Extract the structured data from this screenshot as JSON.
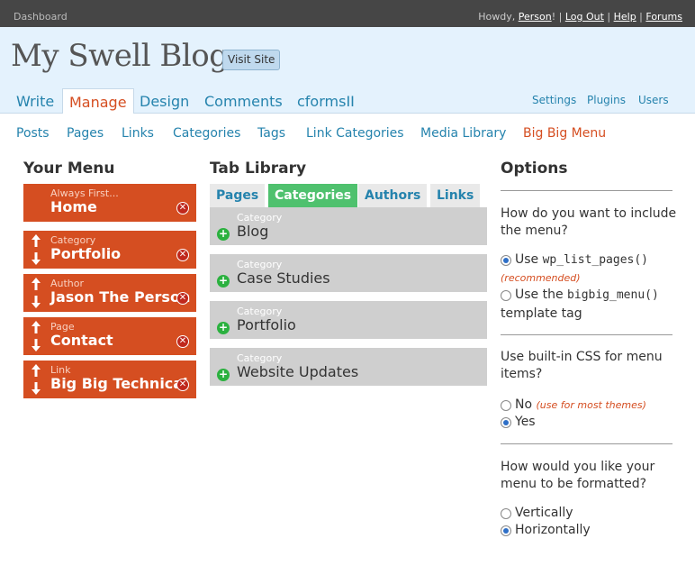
{
  "topbar": {
    "dashboard": "Dashboard",
    "howdy": "Howdy,",
    "user": "Person",
    "links": [
      "Log Out",
      "Help",
      "Forums"
    ]
  },
  "header": {
    "title": "My Swell Blog",
    "visit": "Visit Site"
  },
  "main_tabs": [
    "Write",
    "Manage",
    "Design",
    "Comments",
    "cformsII"
  ],
  "right_links": [
    "Settings",
    "Plugins",
    "Users"
  ],
  "submenu": [
    "Posts",
    "Pages",
    "Links",
    "Categories",
    "Tags",
    "Link Categories",
    "Media Library",
    "Big Big Menu"
  ],
  "your_menu": {
    "heading": "Your Menu",
    "items": [
      {
        "kind": "Always First...",
        "name": "Home"
      },
      {
        "kind": "Category",
        "name": "Portfolio"
      },
      {
        "kind": "Author",
        "name": "Jason The Person"
      },
      {
        "kind": "Page",
        "name": "Contact"
      },
      {
        "kind": "Link",
        "name": "Big Big Technical"
      }
    ]
  },
  "library": {
    "heading": "Tab Library",
    "tabs": [
      "Pages",
      "Categories",
      "Authors",
      "Links"
    ],
    "items": [
      {
        "kind": "Category",
        "name": "Blog"
      },
      {
        "kind": "Category",
        "name": "Case Studies"
      },
      {
        "kind": "Category",
        "name": "Portfolio"
      },
      {
        "kind": "Category",
        "name": "Website Updates"
      }
    ]
  },
  "options": {
    "heading": "Options",
    "q1": "How do you want to include the menu?",
    "q1_a": "Use",
    "q1_a_code": "wp_list_pages()",
    "q1_a_note": "(recommended)",
    "q1_b": "Use the",
    "q1_b_code": "bigbig_menu()",
    "q1_b_tail": "template tag",
    "q2": "Use built-in CSS for menu items?",
    "q2_a": "No",
    "q2_a_note": "(use for most themes)",
    "q2_b": "Yes",
    "q3": "How would you like your menu to be formatted?",
    "q3_a": "Vertically",
    "q3_b": "Horizontally"
  },
  "colors": {
    "accent": "#d54e21",
    "link": "#2583ad",
    "green": "#4fc16e"
  }
}
